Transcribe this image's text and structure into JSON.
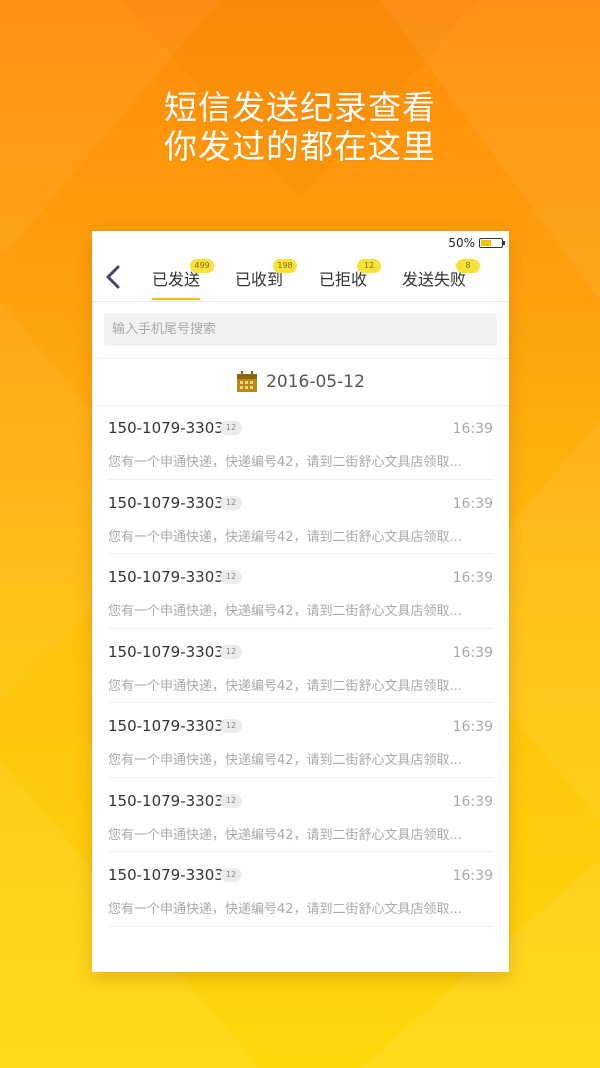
{
  "headline": {
    "line1": "短信发送纪录查看",
    "line2": "你发过的都在这里"
  },
  "status_bar": {
    "battery_text": "50%",
    "battery_level": 0.5
  },
  "tabs": [
    {
      "label": "已发送",
      "badge": "499",
      "active": true
    },
    {
      "label": "已收到",
      "badge": "198",
      "active": false
    },
    {
      "label": "已拒收",
      "badge": "12",
      "active": false
    },
    {
      "label": "发送失败",
      "badge": "8",
      "active": false
    }
  ],
  "search": {
    "placeholder": "输入手机尾号搜索",
    "value": ""
  },
  "date_header": {
    "icon": "calendar-icon",
    "date": "2016-05-12"
  },
  "messages": [
    {
      "phone": "150-1079-3303",
      "count": "12",
      "time": "16:39",
      "preview": "您有一个申通快递，快递编号42，请到二街舒心文具店领取..."
    },
    {
      "phone": "150-1079-3303",
      "count": "12",
      "time": "16:39",
      "preview": "您有一个申通快递，快递编号42，请到二街舒心文具店领取..."
    },
    {
      "phone": "150-1079-3303",
      "count": "12",
      "time": "16:39",
      "preview": "您有一个申通快递，快递编号42，请到二街舒心文具店领取..."
    },
    {
      "phone": "150-1079-3303",
      "count": "12",
      "time": "16:39",
      "preview": "您有一个申通快递，快递编号42，请到二街舒心文具店领取..."
    },
    {
      "phone": "150-1079-3303",
      "count": "12",
      "time": "16:39",
      "preview": "您有一个申通快递，快递编号42，请到二街舒心文具店领取..."
    },
    {
      "phone": "150-1079-3303",
      "count": "12",
      "time": "16:39",
      "preview": "您有一个申通快递，快递编号42，请到二街舒心文具店领取..."
    },
    {
      "phone": "150-1079-3303",
      "count": "12",
      "time": "16:39",
      "preview": "您有一个申通快递，快递编号42，请到二街舒心文具店领取..."
    }
  ],
  "colors": {
    "accent": "#f5c400",
    "badge": "#f7e13a",
    "background_top": "#ff8c0a",
    "background_bottom": "#ffd80a",
    "back_arrow": "#4b3f72"
  }
}
